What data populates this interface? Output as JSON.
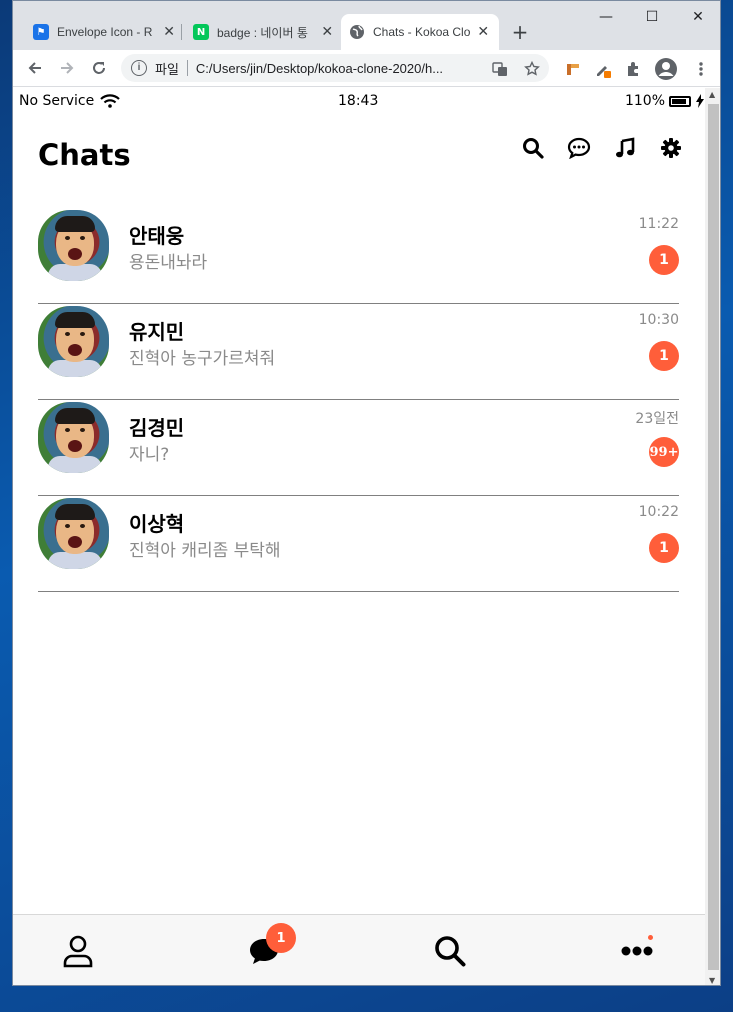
{
  "browser": {
    "tabs": [
      {
        "title": "Envelope Icon - R",
        "favicon": "flag-icon",
        "favicon_color": "#1a73e8"
      },
      {
        "title": "badge : 네이버 통",
        "favicon": "naver-icon",
        "favicon_color": "#03c75a"
      },
      {
        "title": "Chats - Kokoa Clo",
        "favicon": "globe-icon",
        "favicon_color": "#5f6368"
      }
    ],
    "new_tab": "+",
    "window_controls": {
      "minimize": "—",
      "maximize": "☐",
      "close": "✕"
    },
    "omnibox": {
      "protocol_label": "파일",
      "url": "C:/Users/jin/Desktop/kokoa-clone-2020/h..."
    }
  },
  "status_bar": {
    "carrier": "No Service",
    "time": "18:43",
    "battery": "110%"
  },
  "header": {
    "title": "Chats",
    "icons": [
      "search-icon",
      "chat-bubble-icon",
      "music-icon",
      "gear-icon"
    ]
  },
  "chats": [
    {
      "name": "안태웅",
      "preview": "용돈내놔라",
      "time": "11:22",
      "badge": "1"
    },
    {
      "name": "유지민",
      "preview": "진혁아 농구가르쳐줘",
      "time": "10:30",
      "badge": "1"
    },
    {
      "name": "김경민",
      "preview": "자니?",
      "time": "23일전",
      "badge": "99+"
    },
    {
      "name": "이상혁",
      "preview": "진혁아 캐리좀 부탁해",
      "time": "10:22",
      "badge": "1"
    }
  ],
  "tab_bar": {
    "items": [
      {
        "icon": "user-icon"
      },
      {
        "icon": "chat-icon",
        "badge": "1"
      },
      {
        "icon": "search-icon"
      },
      {
        "icon": "more-icon"
      }
    ]
  },
  "colors": {
    "accent": "#ff5e3a",
    "preview_gray": "#8a8a8a"
  }
}
